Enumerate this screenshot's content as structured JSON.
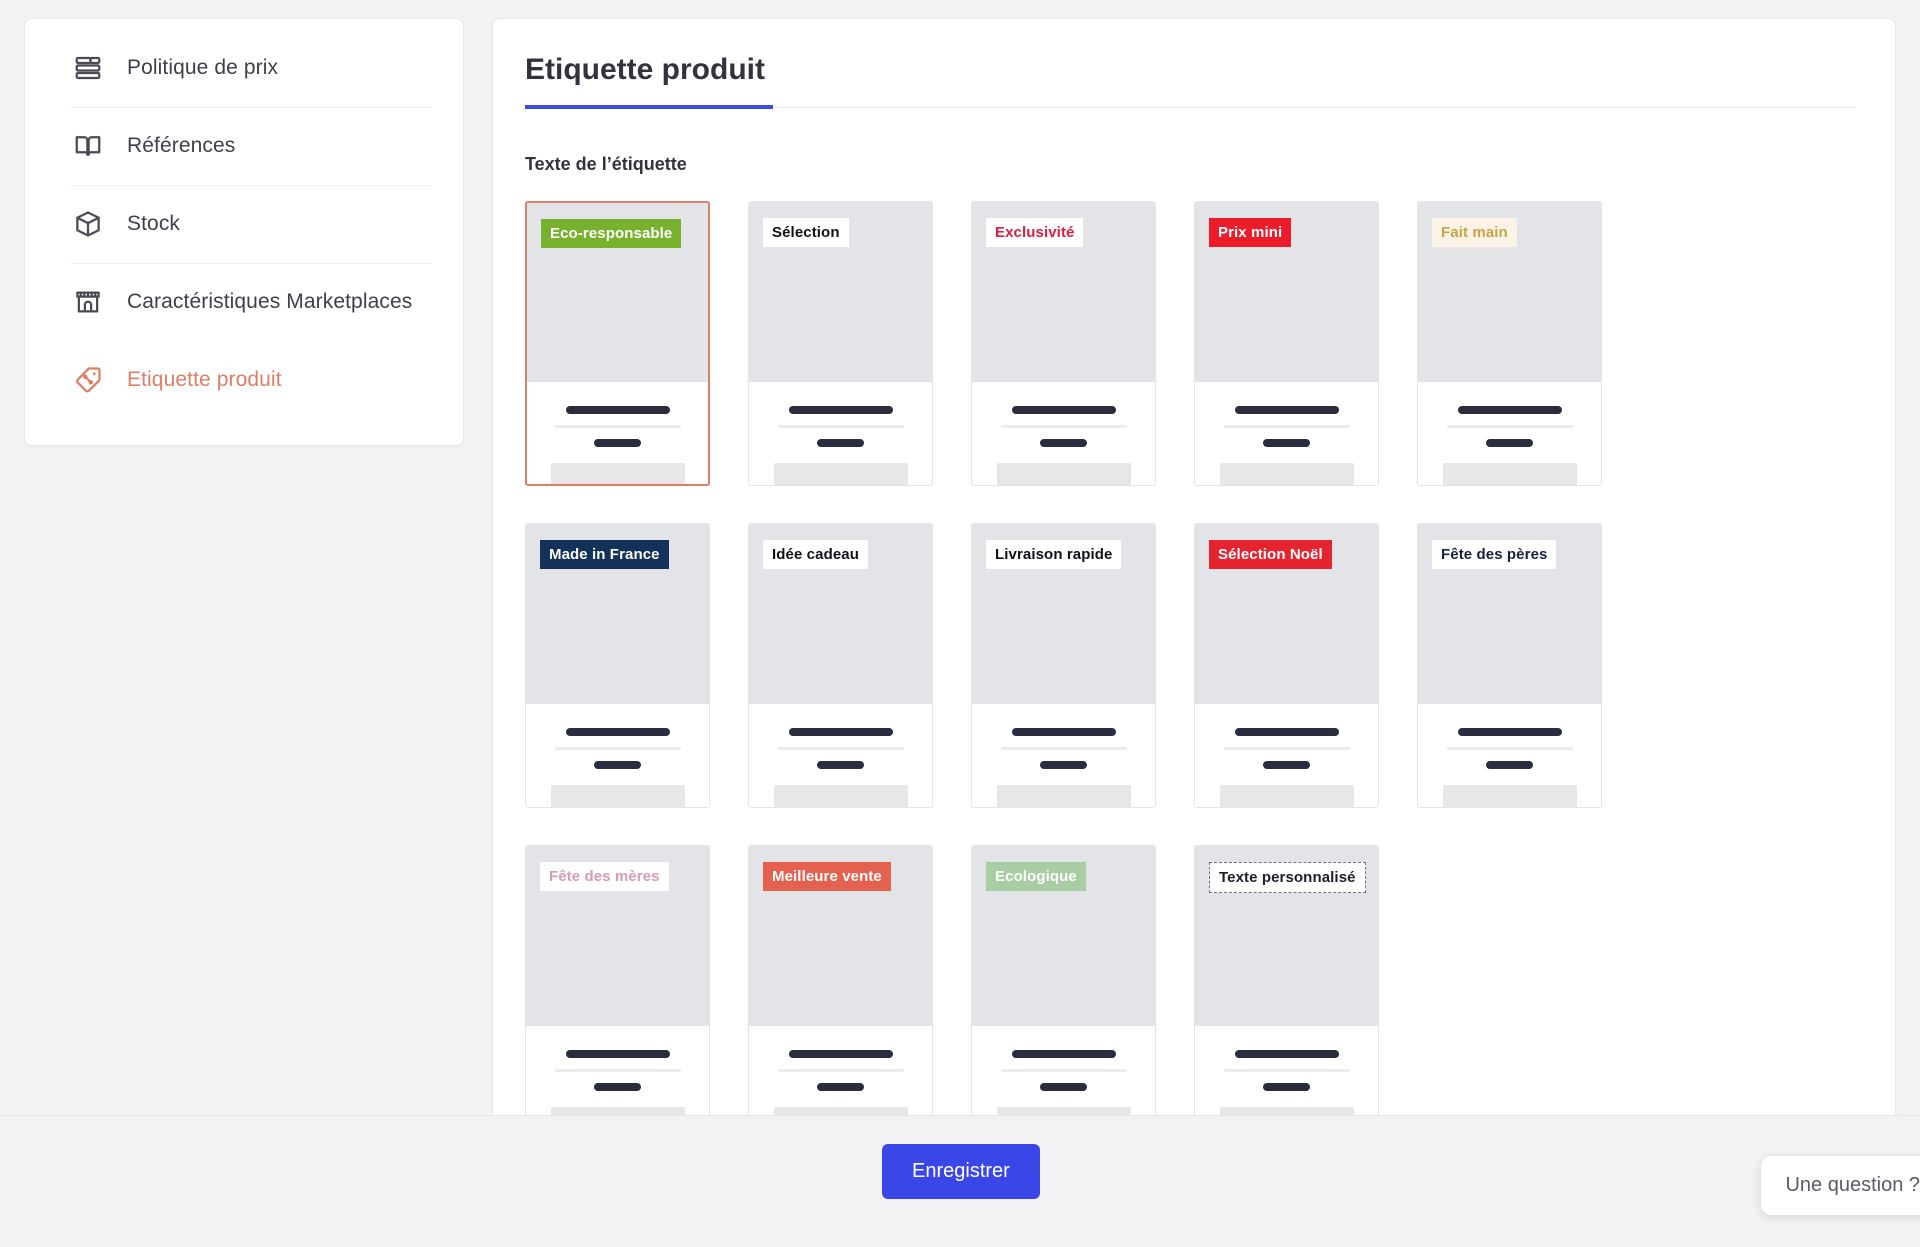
{
  "sidebar": {
    "items": [
      {
        "label": "Politique de prix",
        "icon": "coins-stack-icon",
        "active": false
      },
      {
        "label": "Références",
        "icon": "open-book-icon",
        "active": false
      },
      {
        "label": "Stock",
        "icon": "box-icon",
        "active": false
      },
      {
        "label": "Caractéristiques Marketplaces",
        "icon": "storefront-icon",
        "active": false
      },
      {
        "label": "Etiquette produit",
        "icon": "price-tag-icon",
        "active": true
      }
    ]
  },
  "main": {
    "title": "Etiquette produit",
    "section_label": "Texte de l’étiquette",
    "accent_color": "#3c4fe0",
    "selected_index": 0,
    "labels": [
      {
        "text": "Eco-responsable",
        "bg": "#78b12e",
        "fg": "#ffffff",
        "selected": true,
        "dashed": false
      },
      {
        "text": "Sélection",
        "bg": "#ffffff",
        "fg": "#111118",
        "selected": false,
        "dashed": false
      },
      {
        "text": "Exclusivité",
        "bg": "#ffffff",
        "fg": "#e01b43",
        "selected": false,
        "dashed": false
      },
      {
        "text": "Prix mini",
        "bg": "#ec1c2a",
        "fg": "#ffffff",
        "selected": false,
        "dashed": false
      },
      {
        "text": "Fait main",
        "bg": "#fbf4e6",
        "fg": "#c9a14a",
        "selected": false,
        "dashed": false
      },
      {
        "text": "Made in France",
        "bg": "#143159",
        "fg": "#ffffff",
        "selected": false,
        "dashed": false
      },
      {
        "text": "Idée cadeau",
        "bg": "#ffffff",
        "fg": "#111118",
        "selected": false,
        "dashed": false
      },
      {
        "text": "Livraison rapide",
        "bg": "#ffffff",
        "fg": "#111118",
        "selected": false,
        "dashed": false
      },
      {
        "text": "Sélection Noël",
        "bg": "#e52430",
        "fg": "#ffffff",
        "selected": false,
        "dashed": false
      },
      {
        "text": "Fête des pères",
        "bg": "#ffffff",
        "fg": "#17233d",
        "selected": false,
        "dashed": false
      },
      {
        "text": "Fête des mères",
        "bg": "#ffffff",
        "fg": "#d79bb4",
        "selected": false,
        "dashed": false
      },
      {
        "text": "Meilleure vente",
        "bg": "#e4604f",
        "fg": "#ffffff",
        "selected": false,
        "dashed": false
      },
      {
        "text": "Ecologique",
        "bg": "#a9cda2",
        "fg": "#ffffff",
        "selected": false,
        "dashed": false
      },
      {
        "text": "Texte personnalisé",
        "bg": "#ffffff",
        "fg": "#20202c",
        "selected": false,
        "dashed": true
      }
    ]
  },
  "footer": {
    "save_label": "Enregistrer",
    "save_color": "#3b46e8",
    "help_label": "Une question ?"
  }
}
